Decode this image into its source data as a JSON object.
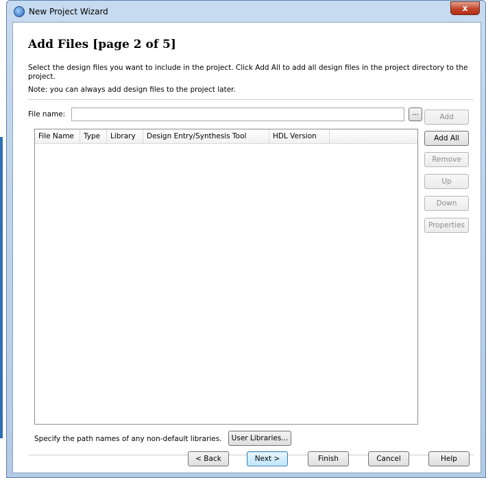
{
  "window": {
    "title": "New Project Wizard",
    "close_glyph": "x"
  },
  "page": {
    "title": "Add Files [page 2 of 5]",
    "description": "Select the design files you want to include in the project. Click Add All to add all design files in the project directory to the project.",
    "note": "Note: you can always add design files to the project later."
  },
  "file_input": {
    "label": "File name:",
    "value": "",
    "browse_label": "..."
  },
  "table": {
    "columns": [
      "File Name",
      "Type",
      "Library",
      "Design Entry/Synthesis Tool",
      "HDL Version"
    ]
  },
  "side_buttons": {
    "add": "Add",
    "add_all": "Add All",
    "remove": "Remove",
    "up": "Up",
    "down": "Down",
    "properties": "Properties"
  },
  "libraries": {
    "text": "Specify the path names of any non-default libraries.",
    "button": "User Libraries..."
  },
  "footer": {
    "back": "< Back",
    "next": "Next >",
    "finish": "Finish",
    "cancel": "Cancel",
    "help": "Help"
  },
  "colors": {
    "title_bar": "#c7dbf0",
    "close_button": "#c2442a",
    "default_button": "#bee6fd"
  }
}
